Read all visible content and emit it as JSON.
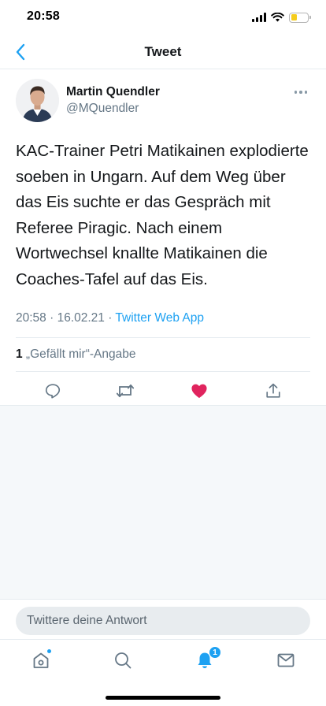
{
  "status_bar": {
    "time": "20:58",
    "battery_level": 0.35,
    "battery_color": "#f5cc1d"
  },
  "nav": {
    "title": "Tweet",
    "back_icon": "chevron-left-icon"
  },
  "tweet": {
    "author_name": "Martin Quendler",
    "author_handle": "@MQuendler",
    "text": "KAC-Trainer Petri Matikainen explodierte soeben in Ungarn. Auf dem Weg über das Eis suchte er das Gespräch mit Referee Piragic. Nach einem Wortwechsel knallte Matikainen die Coaches-Tafel auf das Eis.",
    "time": "20:58",
    "date": "16.02.21",
    "separator": " · ",
    "client": "Twitter Web App",
    "like_count": "1",
    "like_label": " „Gefällt mir“-Angabe",
    "liked": true
  },
  "actions": [
    {
      "name": "reply-icon"
    },
    {
      "name": "retweet-icon"
    },
    {
      "name": "like-heart-icon",
      "active": true
    },
    {
      "name": "share-icon"
    }
  ],
  "reply": {
    "placeholder": "Twittere deine Antwort"
  },
  "tab_bar": {
    "home_has_new": true,
    "notifications_count": "1"
  },
  "colors": {
    "accent": "#1da1f2",
    "like": "#e0245e",
    "secondary_text": "#657786",
    "divider": "#e6ecf0"
  }
}
